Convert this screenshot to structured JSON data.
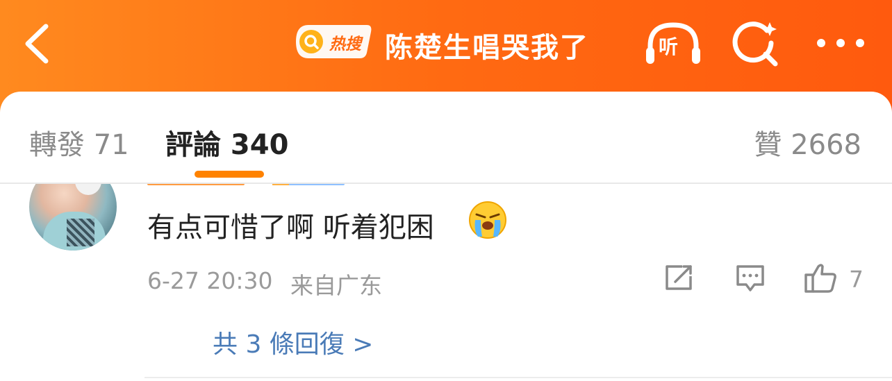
{
  "header": {
    "hot_badge_label": "热搜",
    "hot_topic_title": "陈楚生唱哭我了",
    "listen_label": "听",
    "colors": {
      "bar_start": "#ff8a1f",
      "bar_end": "#ff5a0e"
    }
  },
  "tabs": {
    "repost_label": "轉發 71",
    "comments_label": "評論 340",
    "likes_label": "贊 2668",
    "active_indicator_color": "#ff8200"
  },
  "comment": {
    "text": "有点可惜了啊 听着犯困",
    "emoji": "crying-face",
    "time": "6-27 20:30",
    "location": "来自广东",
    "like_count": "7",
    "replies_link": "共 3 條回復 >"
  }
}
